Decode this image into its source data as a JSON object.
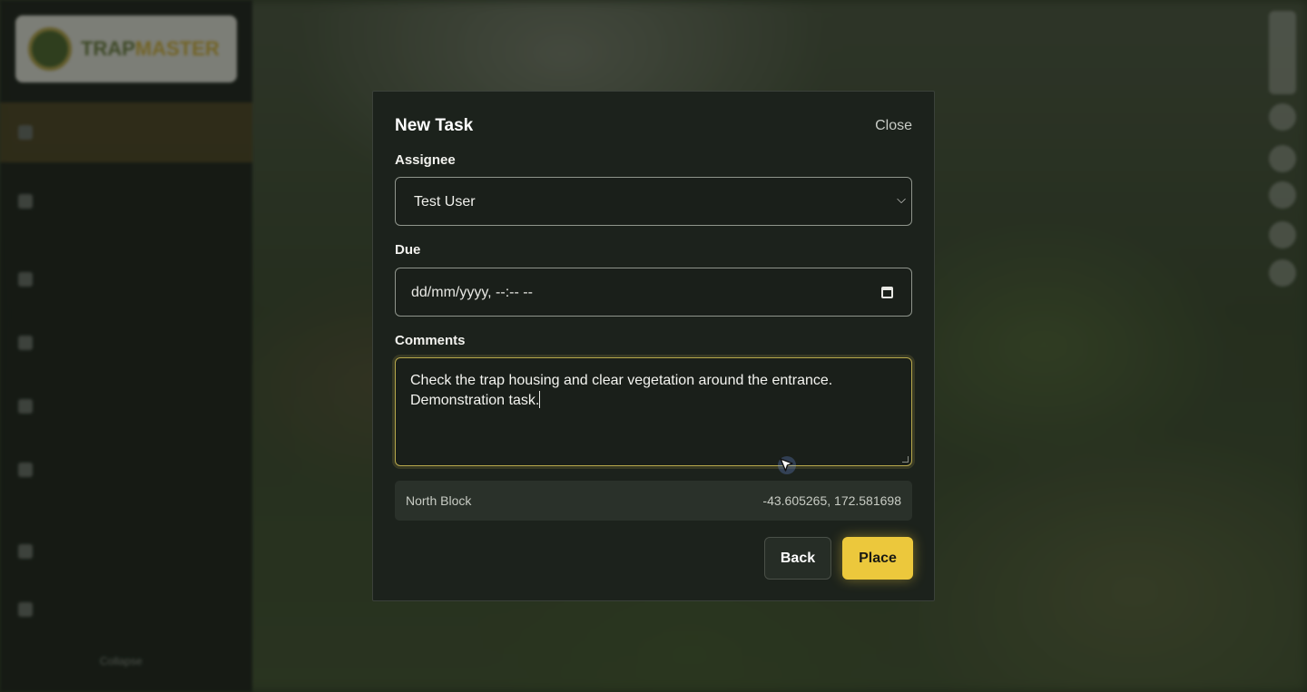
{
  "sidebar": {
    "logo_text_primary": "TRAP",
    "logo_text_accent": "MASTER",
    "footer": "Collapse"
  },
  "modal": {
    "title": "New Task",
    "close_label": "Close",
    "assignee": {
      "label": "Assignee",
      "value": "Test User"
    },
    "due": {
      "label": "Due",
      "placeholder": "dd/mm/yyyy, --:-- --"
    },
    "comments": {
      "label": "Comments",
      "value": "Check the trap housing and clear vegetation around the entrance. Demonstration task."
    },
    "location": {
      "name": "North Block",
      "coords": "-43.605265, 172.581698"
    },
    "buttons": {
      "back": "Back",
      "place": "Place"
    }
  },
  "colors": {
    "accent": "#ecc83c",
    "modal_bg": "#1c221c",
    "focus_border": "#b8a84c"
  },
  "icons": {
    "select_chevron": "chevron-down-icon",
    "date_picker": "calendar-icon",
    "cursor": "mouse-pointer-icon"
  }
}
